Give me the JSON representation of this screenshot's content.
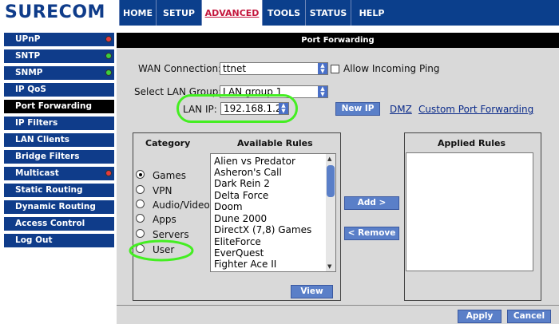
{
  "brand": "SURECOM",
  "nav": [
    "HOME",
    "SETUP",
    "ADVANCED",
    "TOOLS",
    "STATUS",
    "HELP"
  ],
  "sidebar": [
    {
      "label": "UPnP",
      "status": "red"
    },
    {
      "label": "SNTP",
      "status": "green"
    },
    {
      "label": "SNMP",
      "status": "green"
    },
    {
      "label": "IP QoS",
      "status": ""
    },
    {
      "label": "Port Forwarding",
      "status": "",
      "active": true
    },
    {
      "label": "IP Filters",
      "status": ""
    },
    {
      "label": "LAN Clients",
      "status": ""
    },
    {
      "label": "Bridge Filters",
      "status": ""
    },
    {
      "label": "Multicast",
      "status": "red"
    },
    {
      "label": "Static Routing",
      "status": ""
    },
    {
      "label": "Dynamic Routing",
      "status": ""
    },
    {
      "label": "Access Control",
      "status": ""
    },
    {
      "label": "Log Out",
      "status": ""
    }
  ],
  "colors": {
    "red": "#e53a3a",
    "green": "#3ccf3c"
  },
  "page": {
    "title": "Port Forwarding",
    "wan_label": "WAN Connection:",
    "wan_value": "ttnet",
    "allow_ping": "Allow Incoming Ping",
    "lan_group_label": "Select LAN Group:",
    "lan_group_value": "LAN group 1",
    "lan_ip_label": "LAN IP:",
    "lan_ip_value": "192.168.1.2",
    "new_ip": "New IP",
    "dmz": "DMZ",
    "custom": "Custom Port Forwarding"
  },
  "category": {
    "title": "Category",
    "options": [
      "Games",
      "VPN",
      "Audio/Video",
      "Apps",
      "Servers",
      "User"
    ],
    "selected": "Games"
  },
  "rules": {
    "title": "Available Rules",
    "items": [
      "Alien vs Predator",
      "Asheron's Call",
      "Dark Rein 2",
      "Delta Force",
      "Doom",
      "Dune 2000",
      "DirectX (7,8) Games",
      "EliteForce",
      "EverQuest",
      "Fighter Ace II"
    ],
    "view": "View"
  },
  "actions": {
    "add": "Add >",
    "remove": "< Remove"
  },
  "applied": {
    "title": "Applied Rules"
  },
  "bottom": {
    "apply": "Apply",
    "cancel": "Cancel"
  }
}
